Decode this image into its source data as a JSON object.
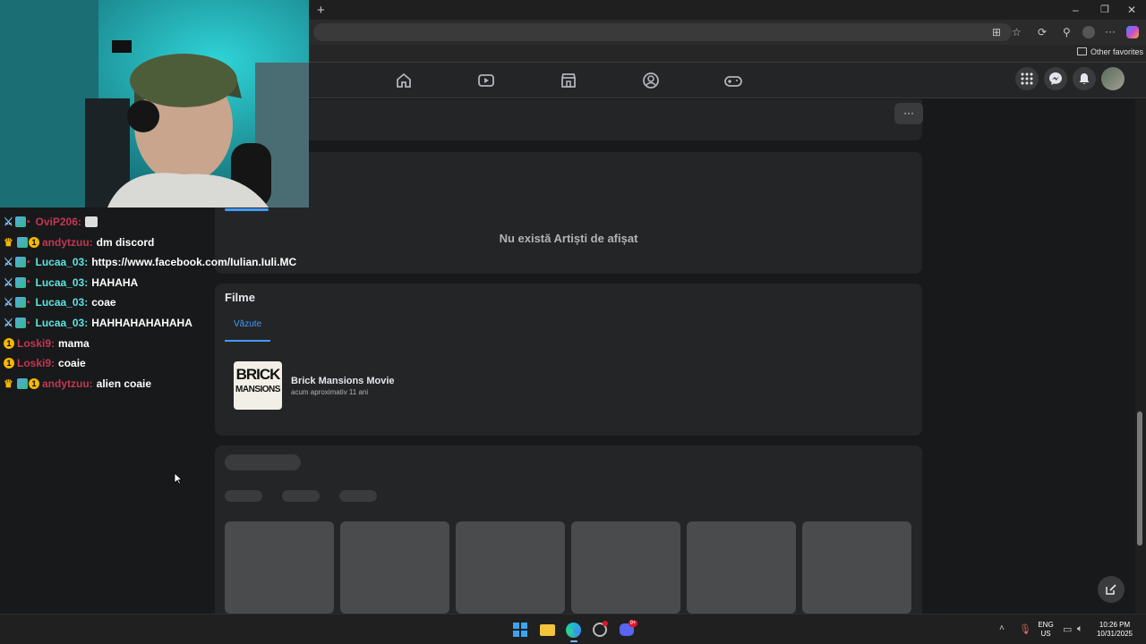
{
  "browser": {
    "new_tab": "+",
    "minimize": "–",
    "restore": "❐",
    "close": "✕",
    "favorites_label": "Other favorites"
  },
  "artists": {
    "empty_text": "Nu există Artiști de afișat"
  },
  "films": {
    "heading": "Filme",
    "tab_label": "Văzute",
    "item_title": "Brick Mansions Movie",
    "item_subtitle": "acum aproximativ 11 ani",
    "poster_line1": "BRICK",
    "poster_line2": "MANSIONS"
  },
  "more_button": "···",
  "chat": [
    {
      "user": "OviP206:",
      "message": "",
      "color": "red",
      "badges": [
        "sword",
        "grid",
        "dot"
      ]
    },
    {
      "user": "andytzuu:",
      "message": "dm discord",
      "color": "red",
      "badges": [
        "crown",
        "grid",
        "one"
      ]
    },
    {
      "user": "Lucaa_03:",
      "message": "https://www.facebook.com/Iulian.Iuli.MC",
      "color": "cyan",
      "badges": [
        "sword",
        "grid",
        "dot"
      ]
    },
    {
      "user": "Lucaa_03:",
      "message": "HAHAHA",
      "color": "cyan",
      "badges": [
        "sword",
        "grid",
        "dot"
      ]
    },
    {
      "user": "Lucaa_03:",
      "message": "coae",
      "color": "cyan",
      "badges": [
        "sword",
        "grid",
        "dot"
      ]
    },
    {
      "user": "Lucaa_03:",
      "message": "HAHHAHAHAHAHA",
      "color": "cyan",
      "badges": [
        "sword",
        "grid",
        "dot"
      ]
    },
    {
      "user": "Loski9:",
      "message": "mama",
      "color": "red",
      "badges": [
        "one"
      ]
    },
    {
      "user": "Loski9:",
      "message": "coaie",
      "color": "red",
      "badges": [
        "one"
      ]
    },
    {
      "user": "andytzuu:",
      "message": "alien coaie",
      "color": "red",
      "badges": [
        "crown",
        "grid",
        "one"
      ]
    }
  ],
  "taskbar": {
    "lang_top": "ENG",
    "lang_bottom": "US",
    "time": "10:26 PM",
    "date": "10/31/2025",
    "discord_badge": "9+"
  },
  "colors": {
    "accent_blue": "#4599ff",
    "chat_cyan": "#5ee3e3",
    "chat_red": "#c23654"
  }
}
